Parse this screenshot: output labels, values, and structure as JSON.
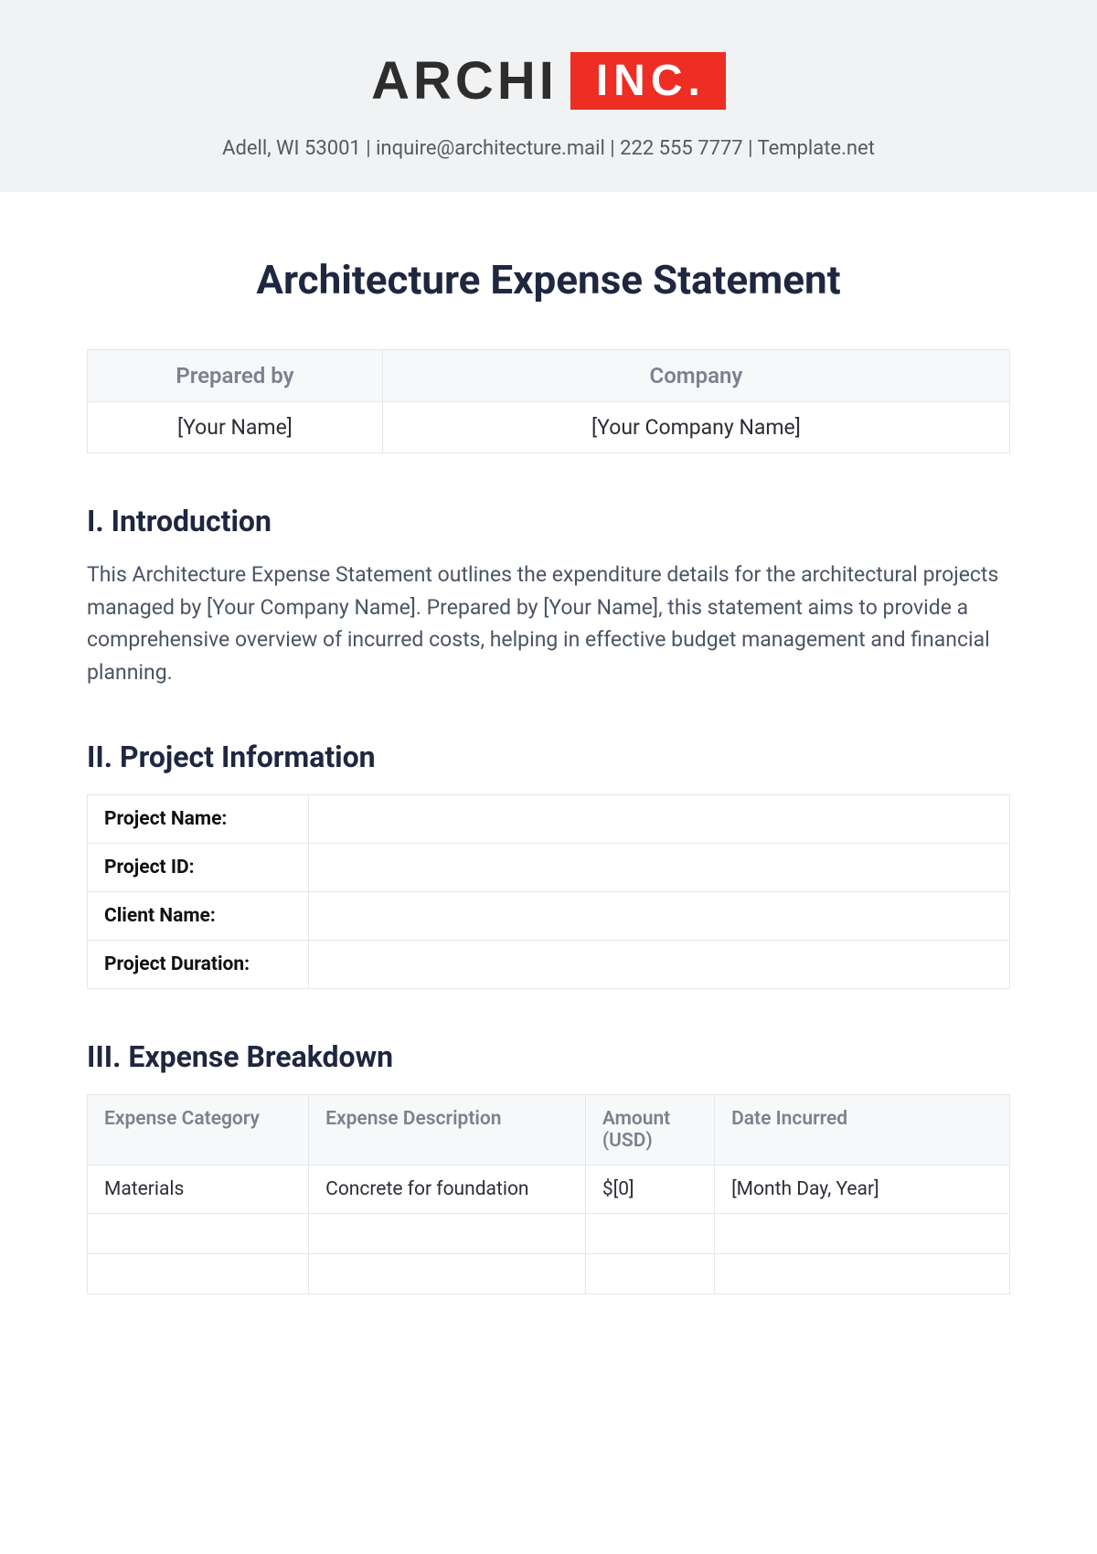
{
  "header": {
    "logo_left": "ARCHI",
    "logo_right": "INC.",
    "contact_line": "Adell, WI 53001 | inquire@architecture.mail | 222 555 7777 | Template.net"
  },
  "title": "Architecture Expense Statement",
  "meta_table": {
    "headers": [
      "Prepared by",
      "Company"
    ],
    "values": [
      "[Your Name]",
      "[Your Company Name]"
    ]
  },
  "sections": {
    "intro": {
      "heading": "I. Introduction",
      "body": "This Architecture Expense Statement outlines the expenditure details for the architectural projects managed by [Your Company Name]. Prepared by [Your Name], this statement aims to provide a comprehensive overview of incurred costs, helping in effective budget management and financial planning."
    },
    "project_info": {
      "heading": "II. Project Information",
      "rows": [
        {
          "label": "Project Name:",
          "value": ""
        },
        {
          "label": "Project ID:",
          "value": ""
        },
        {
          "label": "Client Name:",
          "value": ""
        },
        {
          "label": "Project Duration:",
          "value": ""
        }
      ]
    },
    "breakdown": {
      "heading": "III. Expense Breakdown",
      "columns": [
        "Expense Category",
        "Expense Description",
        "Amount (USD)",
        "Date Incurred"
      ],
      "rows": [
        {
          "category": "Materials",
          "description": "Concrete for foundation",
          "amount": "$[0]",
          "date": "[Month Day, Year]"
        },
        {
          "category": "",
          "description": "",
          "amount": "",
          "date": ""
        },
        {
          "category": "",
          "description": "",
          "amount": "",
          "date": ""
        }
      ]
    }
  }
}
